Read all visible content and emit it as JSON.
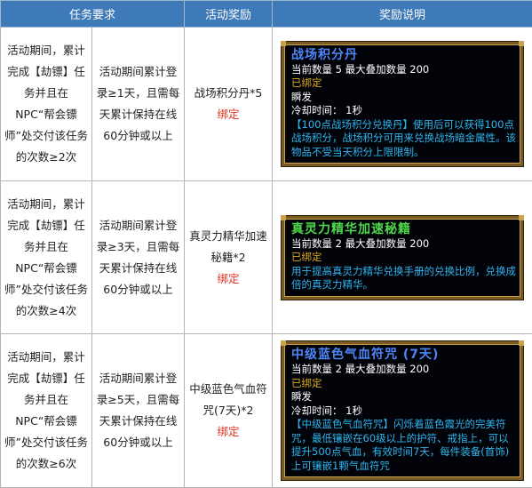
{
  "headers": [
    "任务要求",
    "活动奖励",
    "奖励说明"
  ],
  "rows": [
    {
      "requirement": "活动期间，累计完成【劫镖】任务并且在NPC“帮会镖师”处交付该任务的次数≥2次",
      "condition": "活动期间累计登录≥1天，且需每天累计保持在线60分钟或以上",
      "award": "战场积分丹*5",
      "award_bound": "绑定",
      "tooltip": {
        "name": "战场积分丹",
        "qty": "当前数量 5 最大叠加数量 200",
        "bound": "已绑定",
        "instant": "瞬发",
        "cooldown": "冷却时间：  1秒",
        "desc": "【100点战场积分兑换丹】使用后可以获得100点战场积分，战场积分可用来兑换战场暗金属性。该物品不受当天积分上限限制。"
      }
    },
    {
      "requirement": "活动期间，累计完成【劫镖】任务并且在NPC“帮会镖师”处交付该任务的次数≥4次",
      "condition": "活动期间累计登录≥3天，且需每天累计保持在线60分钟或以上",
      "award": "真灵力精华加速秘籍*2",
      "award_bound": "绑定",
      "tooltip": {
        "name": "真灵力精华加速秘籍",
        "qty": "当前数量 2 最大叠加数量 200",
        "bound": "已绑定",
        "desc": "用于提高真灵力精华兑换手册的兑换比例，兑换成倍的真灵力精华。"
      }
    },
    {
      "requirement": "活动期间，累计完成【劫镖】任务并且在NPC“帮会镖师”处交付该任务的次数≥6次",
      "condition": "活动期间累计登录≥5天，且需每天累计保持在线60分钟或以上",
      "award": "中级蓝色气血符咒(7天)*2",
      "award_bound": "绑定",
      "tooltip": {
        "name": "中级蓝色气血符咒 (7天)",
        "qty": "当前数量 2 最大叠加数量 200",
        "bound": "已绑定",
        "instant": "瞬发",
        "cooldown": "冷却时间：  1秒",
        "desc": "【中级蓝色气血符咒】闪烁着蓝色霞光的完美符咒，最低镶嵌在60级以上的护符、戒指上，可以提升500点气血，有效时间7天，每件装备(首饰)上可镶嵌1颗气血符咒"
      }
    }
  ],
  "colors": {
    "header_bg": "#3e79b8",
    "bound_red": "#e0331e",
    "tip_blue_text": "#2fb6ee",
    "tip_gold": "#d9a91c"
  }
}
